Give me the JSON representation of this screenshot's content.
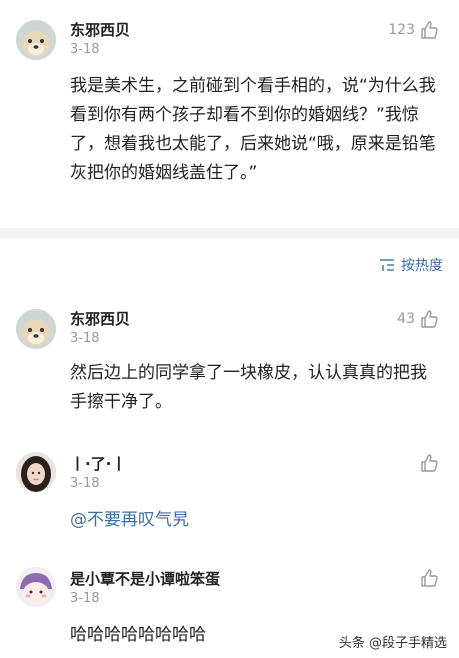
{
  "comments": [
    {
      "username": "东邪西贝",
      "date": "3-18",
      "likes": "123",
      "text": "我是美术生，之前碰到个看手相的，说“为什么我看到你有两个孩子却看不到你的婚姻线？”我惊了，想着我也太能了，后来她说“哦，原来是铅笔灰把你的婚姻线盖住了。”"
    }
  ],
  "sort": {
    "label": "按热度"
  },
  "replies": [
    {
      "username": "东邪西贝",
      "date": "3-18",
      "likes": "43",
      "text": "然后边上的同学拿了一块橡皮，认认真真的把我手擦干净了。"
    },
    {
      "username": "丨·了·丨",
      "date": "3-18",
      "likes": "",
      "text": "@不要再叹气旯"
    },
    {
      "username": "是小覃不是小谭啦笨蛋",
      "date": "3-18",
      "likes": "",
      "text": "哈哈哈哈哈哈哈哈"
    }
  ],
  "watermark": "头条 @段子手精选",
  "colors": {
    "link": "#3e6ea8",
    "meta": "#9a9a9a",
    "divider": "#f2f2f2"
  }
}
